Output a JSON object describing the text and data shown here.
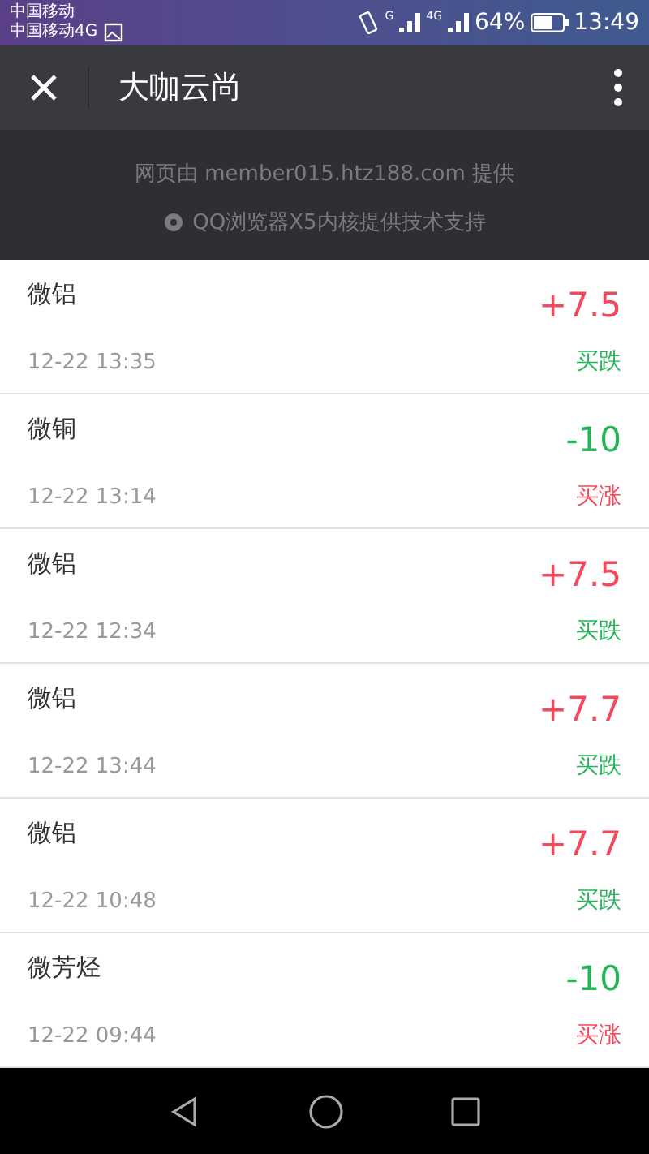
{
  "status_bar": {
    "carrier_1": "中国移动",
    "carrier_2": "中国移动4G",
    "network_1": "G",
    "network_2": "4G",
    "battery_text": "64%",
    "time": "13:49"
  },
  "title_bar": {
    "title": "大咖云尚"
  },
  "provider": {
    "line_1": "网页由 member015.htz188.com 提供",
    "line_2": "QQ浏览器X5内核提供技术支持"
  },
  "records": [
    {
      "name": "微铝",
      "time": "12-22 13:35",
      "amount": {
        "text": "+7.5",
        "color": "#f2495c"
      },
      "action": {
        "text": "买跌",
        "color": "#27b35a"
      }
    },
    {
      "name": "微铜",
      "time": "12-22 13:14",
      "amount": {
        "text": "-10",
        "color": "#27b35a"
      },
      "action": {
        "text": "买涨",
        "color": "#f2495c"
      }
    },
    {
      "name": "微铝",
      "time": "12-22 12:34",
      "amount": {
        "text": "+7.5",
        "color": "#f2495c"
      },
      "action": {
        "text": "买跌",
        "color": "#27b35a"
      }
    },
    {
      "name": "微铝",
      "time": "12-22 13:44",
      "amount": {
        "text": "+7.7",
        "color": "#f2495c"
      },
      "action": {
        "text": "买跌",
        "color": "#27b35a"
      }
    },
    {
      "name": "微铝",
      "time": "12-22 10:48",
      "amount": {
        "text": "+7.7",
        "color": "#f2495c"
      },
      "action": {
        "text": "买跌",
        "color": "#27b35a"
      }
    },
    {
      "name": "微芳烃",
      "time": "12-22 09:44",
      "amount": {
        "text": "-10",
        "color": "#27b35a"
      },
      "action": {
        "text": "买涨",
        "color": "#f2495c"
      }
    }
  ]
}
